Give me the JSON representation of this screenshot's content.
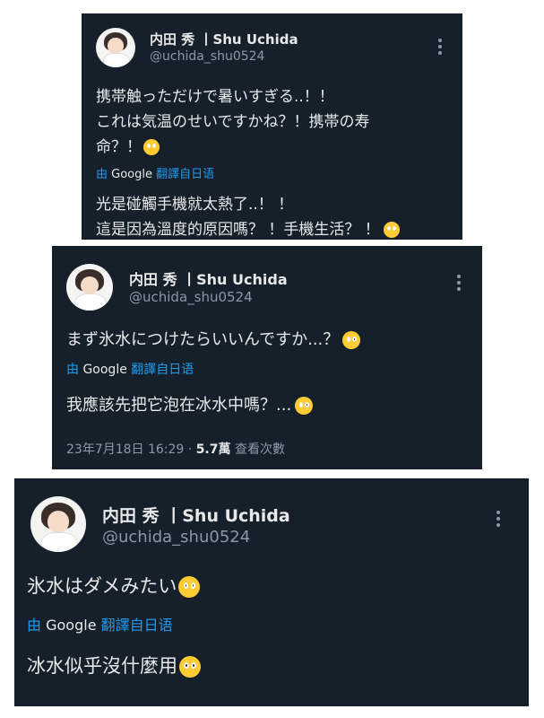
{
  "cards": [
    {
      "user_name": "内田 秀 丨Shu Uchida",
      "handle": "@uchida_shu0524",
      "original_lines": [
        "携帯触っただけで暑いすぎる..！！",
        "これは気温のせいですかね？！携帯の寿",
        "命？！"
      ],
      "translate_prefix": "由",
      "translate_brand": "Google",
      "translate_label": "翻譯自日语",
      "translated_lines": [
        "光是碰觸手機就太熱了..！ ！",
        "這是因為溫度的原因嗎？ ！手機生活？ ！"
      ],
      "emoji": "pleading-face"
    },
    {
      "user_name": "内田 秀 丨Shu Uchida",
      "handle": "@uchida_shu0524",
      "original_lines": [
        "まず氷水につけたらいいんですか...？"
      ],
      "translate_prefix": "由",
      "translate_brand": "Google",
      "translate_label": "翻譯自日语",
      "translated_lines": [
        "我應該先把它泡在冰水中嗎？..."
      ],
      "timestamp": "23年7月18日 16:29 · ",
      "views_count": "5.7萬",
      "views_label": " 查看次數",
      "emoji": "flushed-face"
    },
    {
      "user_name": "内田 秀 丨Shu Uchida",
      "handle": "@uchida_shu0524",
      "original_lines": [
        "氷水はダメみたい"
      ],
      "translate_prefix": "由",
      "translate_brand": "Google",
      "translate_label": "翻譯自日语",
      "translated_lines": [
        "冰水似乎沒什麼用"
      ],
      "emoji": "pleading-face"
    }
  ],
  "colors": {
    "card_bg": "#15202b",
    "text": "#e7e9ea",
    "muted": "#8b98a5",
    "link": "#1d9bf0"
  }
}
